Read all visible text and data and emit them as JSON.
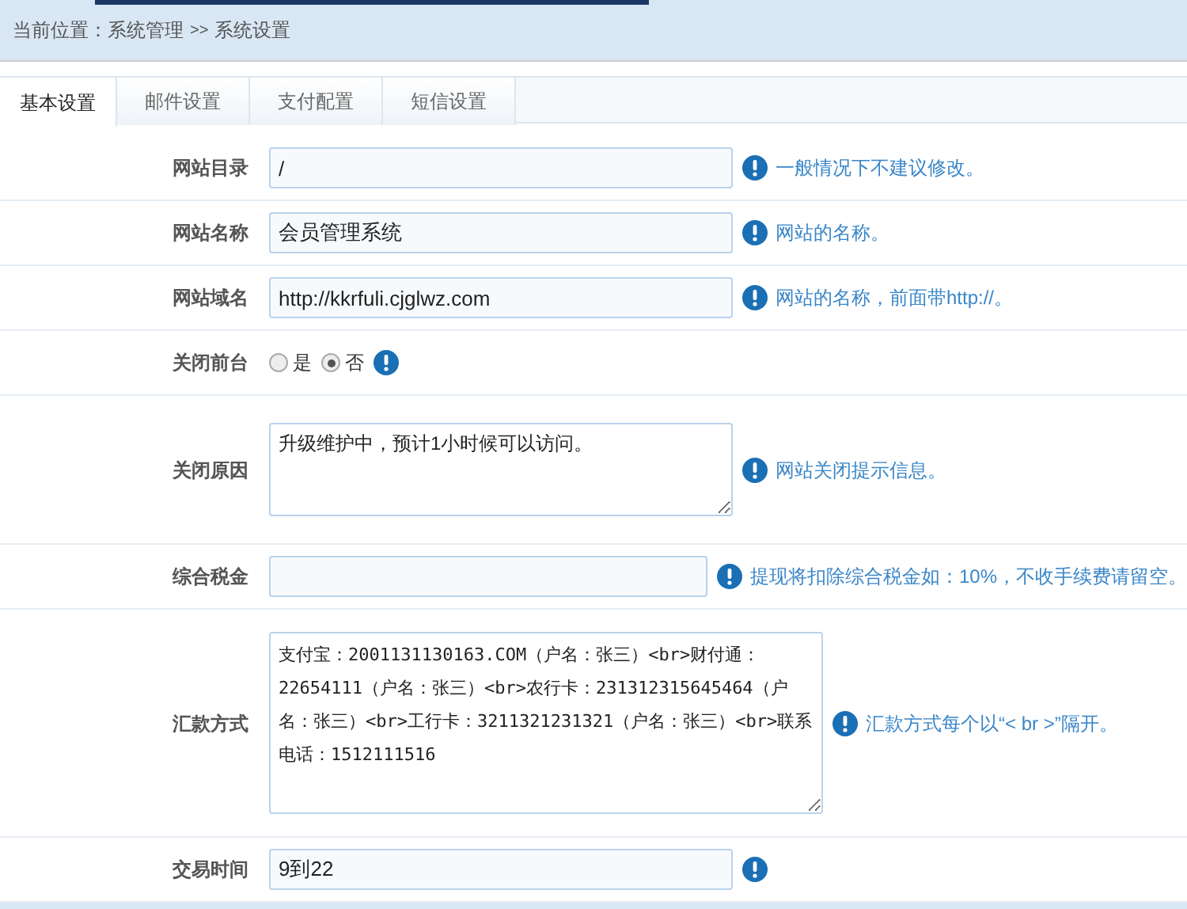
{
  "breadcrumb": {
    "label": "当前位置：",
    "path": [
      "系统管理",
      "系统设置"
    ],
    "separator": ">>"
  },
  "tabs": [
    {
      "label": "基本设置",
      "selected": true
    },
    {
      "label": "邮件设置",
      "selected": false
    },
    {
      "label": "支付配置",
      "selected": false
    },
    {
      "label": "短信设置",
      "selected": false
    }
  ],
  "fields": [
    {
      "kind": "text",
      "label": "网站目录",
      "value": "/",
      "hint": "一般情况下不建议修改。"
    },
    {
      "kind": "text",
      "label": "网站名称",
      "value": "会员管理系统",
      "hint": "网站的名称。"
    },
    {
      "kind": "text",
      "label": "网站域名",
      "value": "http://kkrfuli.cjglwz.com",
      "hint": "网站的名称，前面带http://。"
    },
    {
      "kind": "radio",
      "label": "关闭前台",
      "options": [
        {
          "label": "是",
          "selected": false
        },
        {
          "label": "否",
          "selected": true
        }
      ]
    },
    {
      "kind": "textarea",
      "label": "关闭原因",
      "value": "升级维护中，预计1小时候可以访问。",
      "hint": "网站关闭提示信息。"
    },
    {
      "kind": "text",
      "label": "综合税金",
      "hint": "提现将扣除综合税金如：10%，不收手续费请留空。"
    },
    {
      "kind": "bigtextarea",
      "label": "汇款方式",
      "value": "支付宝：2001131130163.COM（户名：张三）<br>财付通：22654111（户名：张三）<br>农行卡：231312315645464（户名：张三）<br>工行卡：3211321231321（户名：张三）<br>联系电话：1512111516",
      "hint": "汇款方式每个以“< br >”隔开。"
    },
    {
      "kind": "text",
      "label": "交易时间",
      "value": "9到22"
    }
  ]
}
